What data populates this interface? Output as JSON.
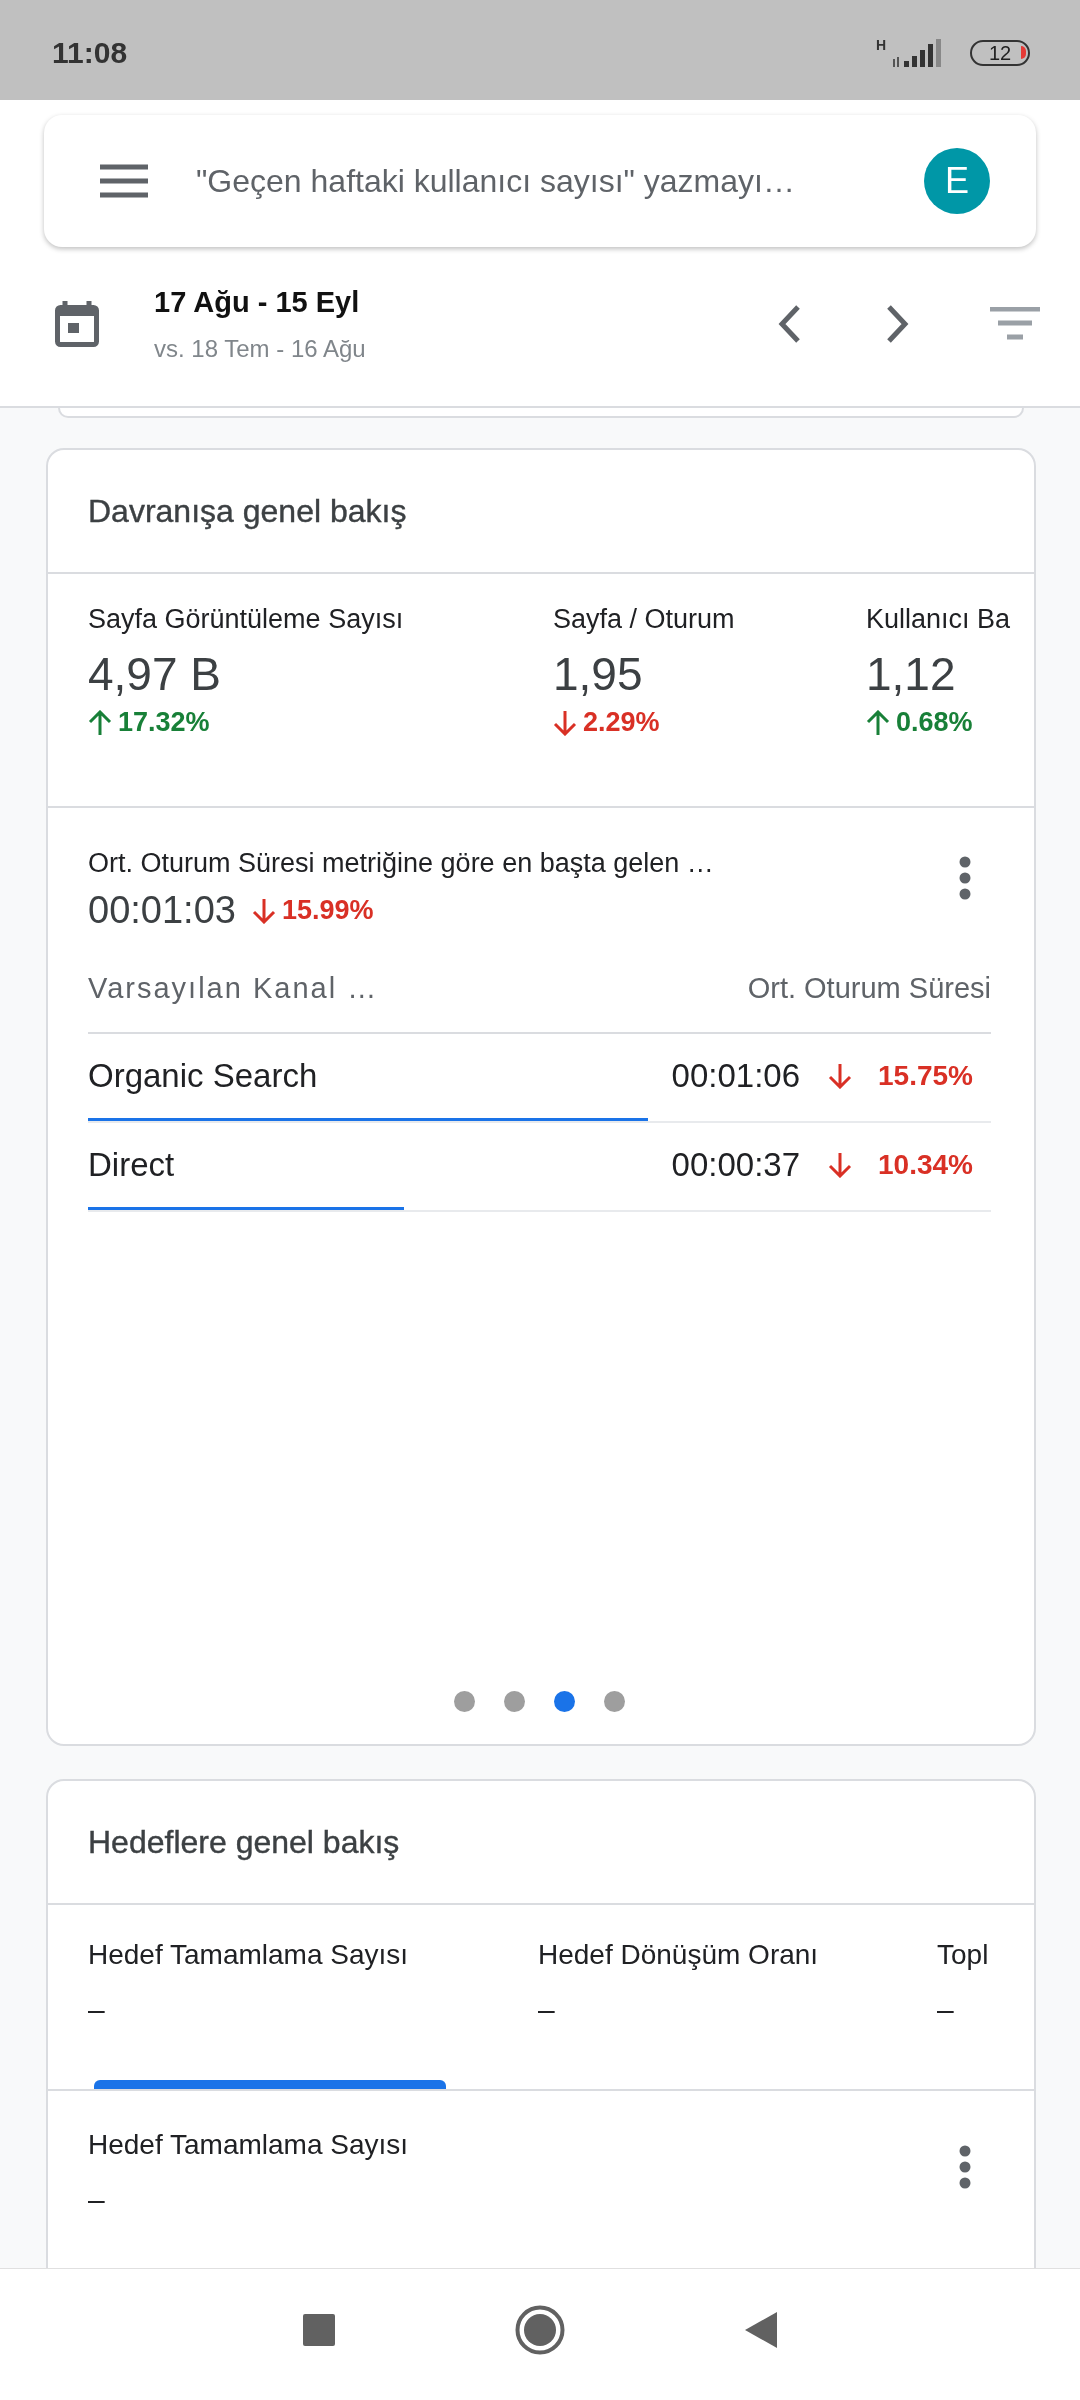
{
  "status_bar": {
    "time": "11:08",
    "network": "H",
    "battery": "12"
  },
  "search": {
    "placeholder": "\"Geçen haftaki kullanıcı sayısı\" yazmayı…",
    "avatar": "E"
  },
  "date_range": {
    "current": "17 Ağu - 15 Eyl",
    "comparison": "vs. 18 Tem - 16 Ağu"
  },
  "behavior_card": {
    "title": "Davranışa genel bakış",
    "metrics": [
      {
        "label": "Sayfa Görüntüleme Sayısı",
        "value": "4,97 B",
        "change": "17.32%",
        "kind": "up"
      },
      {
        "label": "Sayfa / Oturum",
        "value": "1,95",
        "change": "2.29%",
        "kind": "down"
      },
      {
        "label": "Kullanıcı Ba",
        "value": "1,12",
        "change": "0.68%",
        "kind": "up"
      }
    ],
    "detail": {
      "title": "Ort. Oturum Süresi metriğine göre en başta gelen …",
      "value": "00:01:03",
      "change": "15.99%",
      "kind": "down",
      "columns": [
        "Varsayılan Kanal …",
        "Ort. Oturum Süresi"
      ],
      "rows": [
        {
          "name": "Organic Search",
          "value": "00:01:06",
          "change": "15.75%",
          "kind": "down",
          "level": 0.62
        },
        {
          "name": "Direct",
          "value": "00:00:37",
          "change": "10.34%",
          "kind": "down",
          "level": 0.35
        }
      ]
    },
    "pages": [
      {
        "selected": false
      },
      {
        "selected": false
      },
      {
        "selected": true
      },
      {
        "selected": false
      }
    ]
  },
  "goals_card": {
    "title": "Hedeflere genel bakış",
    "metrics": [
      {
        "label": "Hedef Tamamlama Sayısı",
        "value": "–",
        "selected": true
      },
      {
        "label": "Hedef Dönüşüm Oranı",
        "value": "–",
        "selected": false
      },
      {
        "label": "Topl",
        "value": "–",
        "selected": false
      }
    ],
    "detail": {
      "title": "Hedef Tamamlama Sayısı",
      "value": "–"
    }
  }
}
